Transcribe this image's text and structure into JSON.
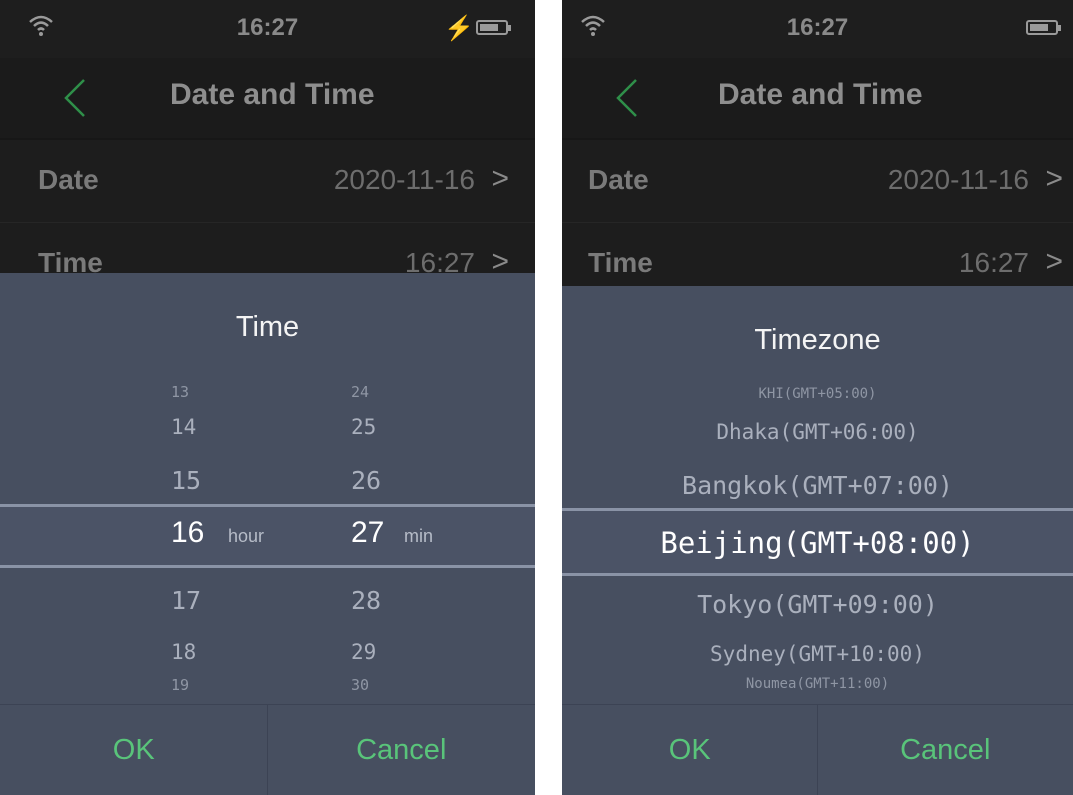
{
  "left_screen": {
    "status": {
      "time": "16:27"
    },
    "nav": {
      "title": "Date and Time"
    },
    "rows": {
      "date": {
        "label": "Date",
        "value": "2020-11-16"
      },
      "time": {
        "label": "Time",
        "value": "16:27"
      }
    },
    "picker": {
      "title": "Time",
      "hours_above": [
        "13",
        "14",
        "15"
      ],
      "hour_selected": "16",
      "hour_unit": "hour",
      "hours_below": [
        "17",
        "18",
        "19"
      ],
      "minutes_above": [
        "24",
        "25",
        "26"
      ],
      "minute_selected": "27",
      "minute_unit": "min",
      "minutes_below": [
        "28",
        "29",
        "30"
      ]
    },
    "buttons": {
      "ok": "OK",
      "cancel": "Cancel"
    }
  },
  "right_screen": {
    "status": {
      "time": "16:27"
    },
    "nav": {
      "title": "Date and Time"
    },
    "rows": {
      "date": {
        "label": "Date",
        "value": "2020-11-16"
      },
      "time": {
        "label": "Time",
        "value": "16:27"
      }
    },
    "picker": {
      "title": "Timezone",
      "above": [
        "KHI(GMT+05:00)",
        "Dhaka(GMT+06:00)",
        "Bangkok(GMT+07:00)"
      ],
      "selected": "Beijing(GMT+08:00)",
      "below": [
        "Tokyo(GMT+09:00)",
        "Sydney(GMT+10:00)",
        "Noumea(GMT+11:00)"
      ]
    },
    "buttons": {
      "ok": "OK",
      "cancel": "Cancel"
    }
  },
  "colors": {
    "accent": "#59c47a",
    "sheet_background": "#474f60",
    "screen_background": "#171717"
  },
  "icons": [
    "wifi-icon",
    "charging-icon",
    "battery-icon",
    "back-arrow-icon",
    "chevron-right-icon"
  ]
}
